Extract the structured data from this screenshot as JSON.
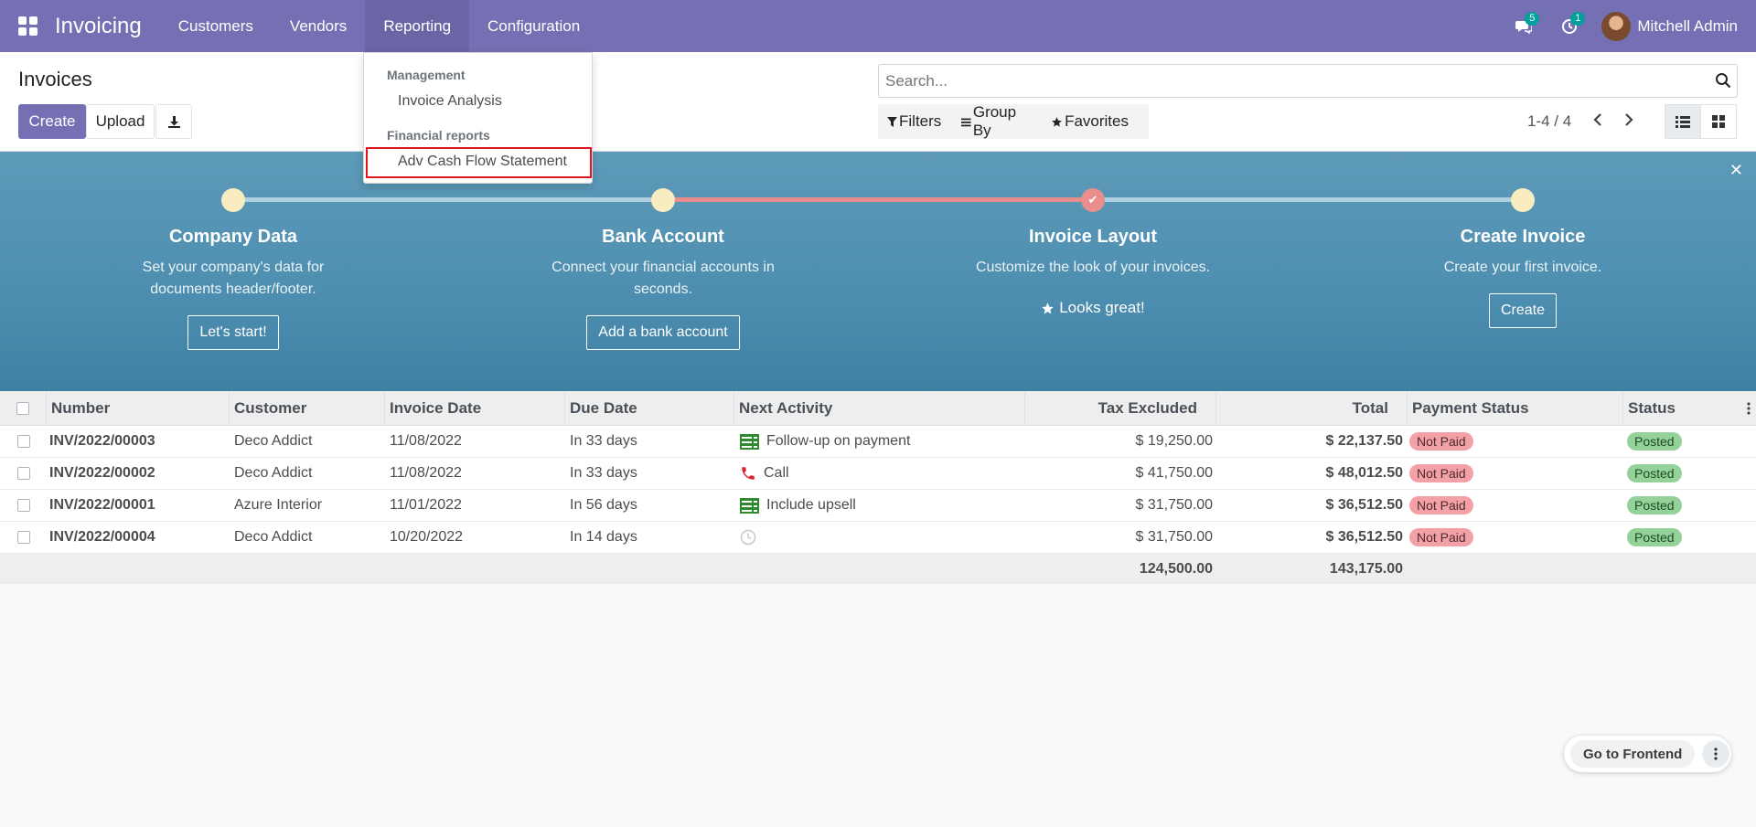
{
  "navbar": {
    "app_name": "Invoicing",
    "menu": [
      "Customers",
      "Vendors",
      "Reporting",
      "Configuration"
    ],
    "messages_count": "5",
    "activities_count": "1",
    "user_name": "Mitchell Admin",
    "color": "#7470b3"
  },
  "control": {
    "title": "Invoices",
    "create_label": "Create",
    "upload_label": "Upload",
    "search_placeholder": "Search...",
    "filters_label": "Filters",
    "groupby_label": "Group By",
    "favorites_label": "Favorites",
    "pager": "1-4 / 4"
  },
  "dropdown": {
    "section1": "Management",
    "item1": "Invoice Analysis",
    "section2": "Financial reports",
    "item2": "Adv Cash Flow Statement"
  },
  "banner": {
    "steps": [
      {
        "title": "Company Data",
        "desc": "Set your company's data for documents header/footer.",
        "button": "Let's start!"
      },
      {
        "title": "Bank Account",
        "desc": "Connect your financial accounts in seconds.",
        "button": "Add a bank account"
      },
      {
        "title": "Invoice Layout",
        "desc": "Customize the look of your invoices.",
        "done": "Looks great!"
      },
      {
        "title": "Create Invoice",
        "desc": "Create your first invoice.",
        "button": "Create"
      }
    ]
  },
  "table": {
    "columns": [
      "Number",
      "Customer",
      "Invoice Date",
      "Due Date",
      "Next Activity",
      "Tax Excluded",
      "Total",
      "Payment Status",
      "Status"
    ],
    "rows": [
      {
        "number": "INV/2022/00003",
        "customer": "Deco Addict",
        "invoice_date": "11/08/2022",
        "due": "In 33 days",
        "activity": "Follow-up on payment",
        "activity_icon": "list-icon",
        "tax_excluded": "$ 19,250.00",
        "total": "$ 22,137.50",
        "payment": "Not Paid",
        "status": "Posted"
      },
      {
        "number": "INV/2022/00002",
        "customer": "Deco Addict",
        "invoice_date": "11/08/2022",
        "due": "In 33 days",
        "activity": "Call",
        "activity_icon": "phone-icon",
        "tax_excluded": "$ 41,750.00",
        "total": "$ 48,012.50",
        "payment": "Not Paid",
        "status": "Posted"
      },
      {
        "number": "INV/2022/00001",
        "customer": "Azure Interior",
        "invoice_date": "11/01/2022",
        "due": "In 56 days",
        "activity": "Include upsell",
        "activity_icon": "list-icon",
        "tax_excluded": "$ 31,750.00",
        "total": "$ 36,512.50",
        "payment": "Not Paid",
        "status": "Posted"
      },
      {
        "number": "INV/2022/00004",
        "customer": "Deco Addict",
        "invoice_date": "10/20/2022",
        "due": "In 14 days",
        "activity": "",
        "activity_icon": "clock-icon",
        "tax_excluded": "$ 31,750.00",
        "total": "$ 36,512.50",
        "payment": "Not Paid",
        "status": "Posted"
      }
    ],
    "totals": {
      "tax_excluded": "124,500.00",
      "total": "143,175.00"
    }
  },
  "frontend": {
    "label": "Go to Frontend"
  }
}
